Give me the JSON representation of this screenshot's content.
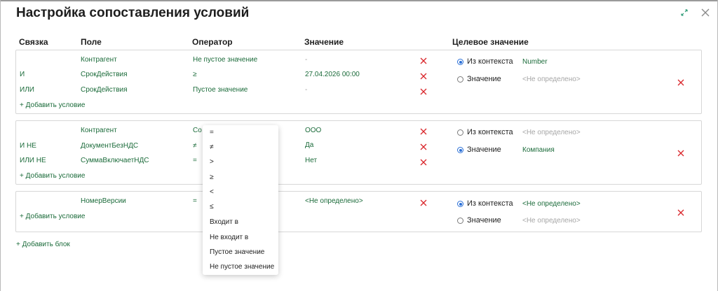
{
  "dialog": {
    "title": "Настройка сопоставления условий"
  },
  "columns": {
    "link": "Связка",
    "field": "Поле",
    "operator": "Оператор",
    "value": "Значение",
    "target": "Целевое значение"
  },
  "blocks": [
    {
      "conditions": [
        {
          "link": "",
          "field": "Контрагент",
          "operator": "Не пустое значение",
          "value": "-"
        },
        {
          "link": "И",
          "field": "СрокДействия",
          "operator": "≥",
          "value": "27.04.2026 00:00"
        },
        {
          "link": "ИЛИ",
          "field": "СрокДействия",
          "operator": "Пустое значение",
          "value": "-"
        }
      ],
      "add_condition": "+ Добавить условие",
      "target": {
        "from_context_label": "Из контекста",
        "from_context_value": "Number",
        "value_label": "Значение",
        "value_value": "<Не определено>",
        "selected": "from_context"
      }
    },
    {
      "conditions": [
        {
          "link": "",
          "field": "Контрагент",
          "operator": "Со",
          "value": "ООО"
        },
        {
          "link": "И НЕ",
          "field": "ДокументБезНДС",
          "operator": "≠",
          "value": "Да"
        },
        {
          "link": "ИЛИ НЕ",
          "field": "СуммаВключаетНДС",
          "operator": "=",
          "value": "Нет"
        }
      ],
      "add_condition": "+ Добавить условие",
      "target": {
        "from_context_label": "Из контекста",
        "from_context_value": "<Не определено>",
        "value_label": "Значение",
        "value_value": "Компания",
        "selected": "value"
      }
    },
    {
      "conditions": [
        {
          "link": "",
          "field": "НомерВерсии",
          "operator": "=",
          "value": "<Не определено>"
        }
      ],
      "add_condition": "+ Добавить условие",
      "target": {
        "from_context_label": "Из контекста",
        "from_context_value": "<Не определено>",
        "value_label": "Значение",
        "value_value": "<Не определено>",
        "selected": "from_context"
      }
    }
  ],
  "add_block": "+ Добавить блок",
  "operator_dropdown": {
    "options": [
      "=",
      "≠",
      ">",
      "≥",
      "<",
      "≤",
      "Входит в",
      "Не входит в",
      "Пустое значение",
      "Не пустое значение"
    ]
  },
  "colors": {
    "accent_green": "#1b6b3a",
    "delete_red": "#d9262b",
    "radio_blue": "#2a6fd6",
    "placeholder_gray": "#a6a6a6"
  },
  "icons": {
    "expand": "expand-arrows-icon",
    "close": "close-icon",
    "delete": "delete-x-icon"
  }
}
